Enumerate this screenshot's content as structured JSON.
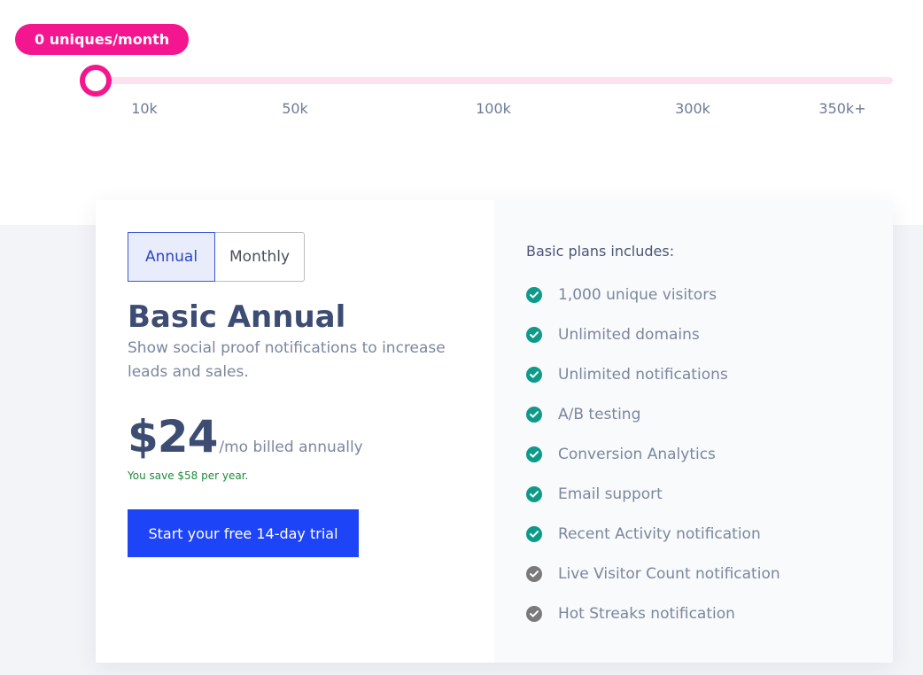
{
  "slider": {
    "bubble_label": "0 uniques/month",
    "value": 0,
    "ticks": [
      {
        "label": "10k"
      },
      {
        "label": "50k"
      },
      {
        "label": "100k"
      },
      {
        "label": "300k"
      },
      {
        "label": "350k+"
      }
    ]
  },
  "billing_toggle": {
    "annual_label": "Annual",
    "monthly_label": "Monthly",
    "selected": "Annual"
  },
  "plan": {
    "title": "Basic Annual",
    "description": "Show social proof notifications to increase leads and sales.",
    "price": "$24",
    "price_period": "/mo billed annually",
    "savings": "You save $58 per year.",
    "cta_label": "Start your free 14-day trial"
  },
  "features": {
    "title": "Basic plans includes:",
    "items": [
      {
        "label": "1,000 unique visitors",
        "status": "included"
      },
      {
        "label": "Unlimited domains",
        "status": "included"
      },
      {
        "label": "Unlimited notifications",
        "status": "included"
      },
      {
        "label": "A/B testing",
        "status": "included"
      },
      {
        "label": "Conversion Analytics",
        "status": "included"
      },
      {
        "label": "Email support",
        "status": "included"
      },
      {
        "label": "Recent Activity notification",
        "status": "included"
      },
      {
        "label": "Live Visitor Count notification",
        "status": "excluded"
      },
      {
        "label": "Hot Streaks notification",
        "status": "excluded"
      }
    ]
  },
  "colors": {
    "accent_pink": "#f4168e",
    "slider_track": "#fde1ee",
    "primary_blue": "#1e44f8",
    "check_included": "#0e9a8a",
    "check_excluded": "#7a7a7a",
    "savings_green": "#1e8a3a",
    "title_navy": "#3d4c72"
  },
  "icons": {
    "check": "check-circle-icon"
  }
}
